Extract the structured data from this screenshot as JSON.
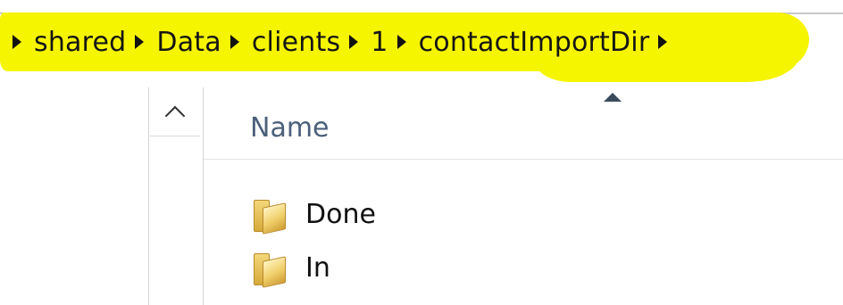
{
  "breadcrumb": {
    "items": [
      "shared",
      "Data",
      "clients",
      "1",
      "contactImportDir"
    ]
  },
  "file_list": {
    "column_name": "Name",
    "rows": [
      {
        "label": "Done",
        "icon": "folder-icon"
      },
      {
        "label": "In",
        "icon": "folder-icon"
      }
    ]
  },
  "colors": {
    "highlight": "#f6f500",
    "header_text": "#4c607a"
  }
}
